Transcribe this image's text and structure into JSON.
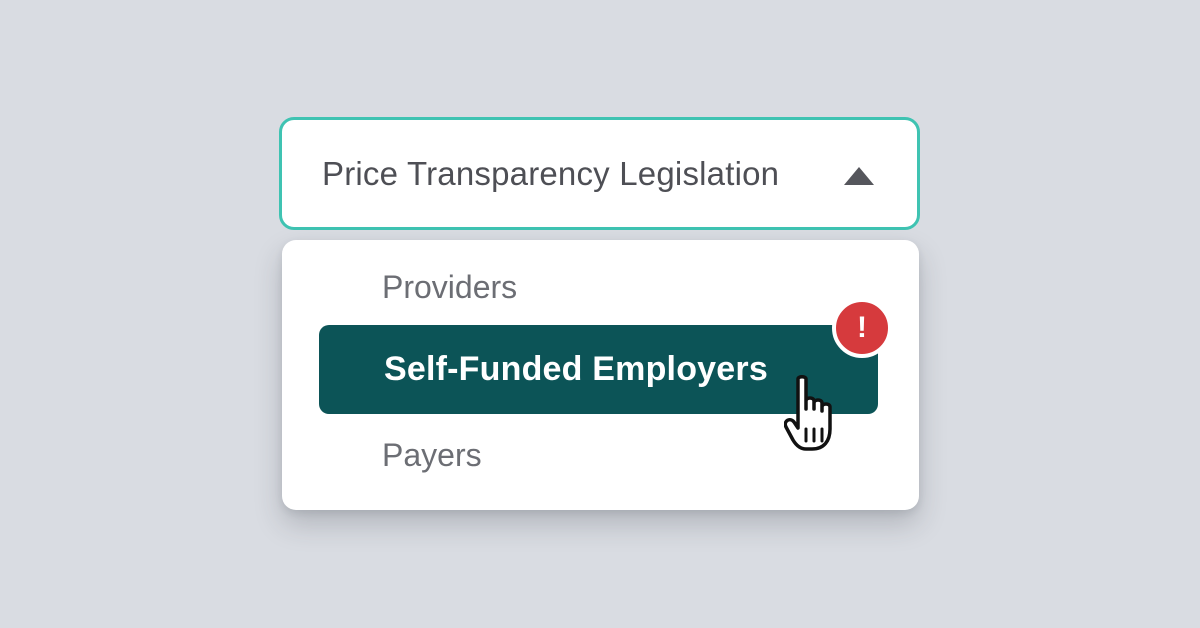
{
  "dropdown": {
    "selected_label": "Price Transparency Legislation",
    "caret_icon": "caret-up-icon",
    "open": true,
    "options": [
      {
        "label": "Providers",
        "selected": false
      },
      {
        "label": "Self-Funded Employers",
        "selected": true
      },
      {
        "label": "Payers",
        "selected": false
      }
    ]
  },
  "alert_badge": {
    "symbol": "!",
    "icon": "exclamation-icon"
  },
  "cursor": {
    "icon": "hand-pointer-icon"
  },
  "colors": {
    "background": "#d9dce2",
    "border_accent": "#3fc3b2",
    "selected_bg": "#0c5457",
    "alert_red": "#d63a3d",
    "text_dark": "#4e4f55",
    "text_muted": "#6c6e74"
  }
}
